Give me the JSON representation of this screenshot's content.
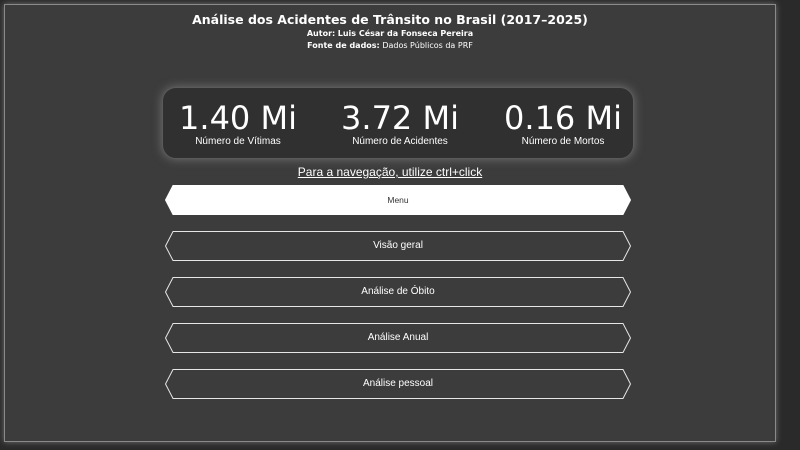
{
  "header": {
    "title": "Análise dos Acidentes de Trânsito no Brasil (2017–2025)",
    "author_label": "Autor:",
    "author_value": "Luis César da Fonseca Pereira",
    "source_label": "Fonte de dados:",
    "source_value": "Dados Públicos da PRF"
  },
  "kpis": [
    {
      "value": "1.40 Mi",
      "label": "Número de Vítimas"
    },
    {
      "value": "3.72 Mi",
      "label": "Número de Acidentes"
    },
    {
      "value": "0.16 Mi",
      "label": "Número de Mortos"
    }
  ],
  "nav_hint": "Para a navegação, utilize ctrl+click",
  "nav": {
    "menu": "Menu",
    "overview": "Visão geral",
    "deaths": "Análise de Óbito",
    "annual": "Análise Anual",
    "personal": "Análise pessoal"
  },
  "colors": {
    "background": "#3c3c3c",
    "active_button": "#ffffff",
    "button_border": "#e6e6e6"
  }
}
